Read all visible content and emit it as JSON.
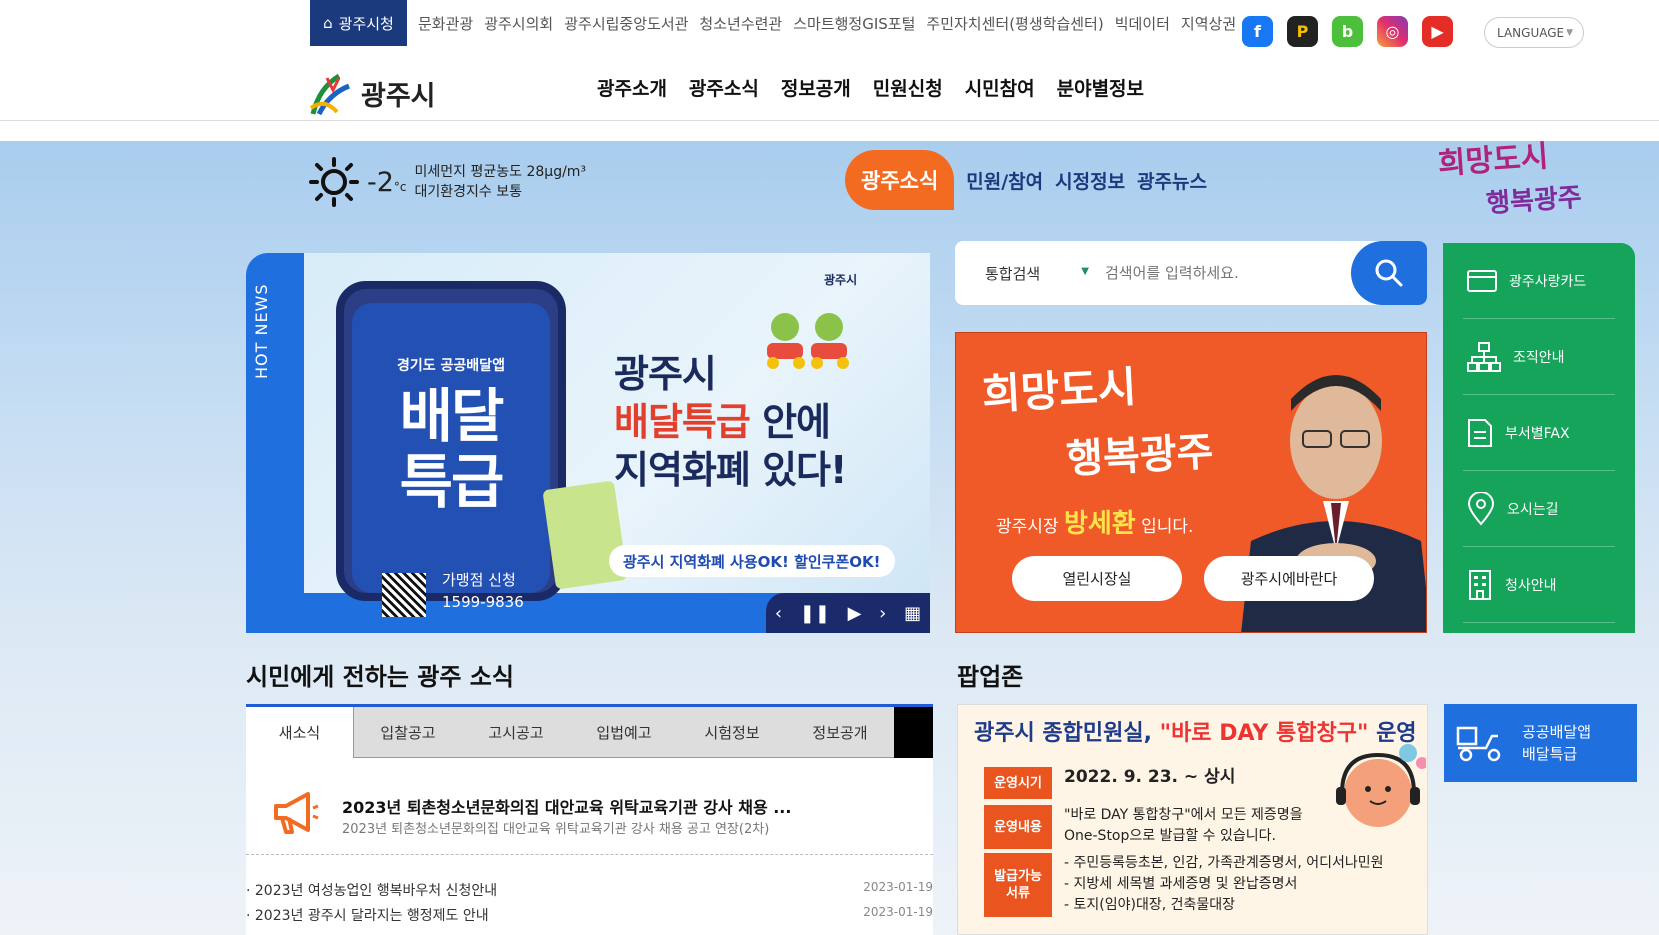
{
  "topbar": {
    "home_label": "광주시청",
    "links": [
      "문화관광",
      "광주시의회",
      "광주시립중앙도서관",
      "청소년수련관",
      "스마트행정GIS포털",
      "주민자치센터(평생학습센터)",
      "빅데이터",
      "지역상권"
    ],
    "language": "LANGUAGE"
  },
  "logo": {
    "name": "광주시"
  },
  "gnb": [
    "광주소개",
    "광주소식",
    "정보공개",
    "민원신청",
    "시민참여",
    "분야별정보"
  ],
  "weather": {
    "temp": "-2",
    "unit": "°c",
    "dust": "미세먼지 평균농도 28μg/m³",
    "air": "대기환경지수 보통"
  },
  "news_tabs": {
    "active": "광주소식",
    "others": [
      "민원/참여",
      "시정정보",
      "광주뉴스"
    ]
  },
  "slogan": {
    "line1": "희망도시",
    "line2": "행복광주"
  },
  "hot_news": {
    "label": "HOT NEWS",
    "phone_title": "경기도 공공배달앱",
    "phone_big1": "배달",
    "phone_big2": "특급",
    "shop_label": "가맹점 신청",
    "shop_phone": "1599-9836",
    "line1": "광주시",
    "line2a": "배달특급",
    "line2b": " 안에",
    "line3": "지역화폐 있다!",
    "sub": "광주시 지역화폐 사용OK! 할인쿠폰OK!",
    "brand": "광주시"
  },
  "search": {
    "category": "통합검색",
    "placeholder": "검색어를 입력하세요."
  },
  "mayor": {
    "cal1": "희망도시",
    "cal2": "행복광주",
    "prefix": "광주시장 ",
    "name": "방세환",
    "suffix": " 입니다.",
    "btn1": "열린시장실",
    "btn2": "광주시에바란다"
  },
  "quick_menu": [
    {
      "label": "광주사랑카드",
      "icon": "card-icon"
    },
    {
      "label": "조직안내",
      "icon": "org-chart-icon"
    },
    {
      "label": "부서별FAX",
      "icon": "fax-icon"
    },
    {
      "label": "오시는길",
      "icon": "location-pin-icon"
    },
    {
      "label": "청사안내",
      "icon": "building-icon"
    }
  ],
  "section_news": {
    "title": "시민에게 전하는 광주 소식"
  },
  "section_popup": {
    "title": "팝업존"
  },
  "board_tabs": [
    "새소식",
    "입찰공고",
    "고시공고",
    "입법예고",
    "시험정보",
    "정보공개"
  ],
  "featured": {
    "title": "2023년 퇴촌청소년문화의집 대안교육 위탁교육기관 강사 채용 ...",
    "summary": "2023년 퇴촌청소년문화의집 대안교육 위탁교육기관 강사 채용 공고 연장(2차)"
  },
  "news_list": [
    {
      "title": "· 2023년 여성농업인 행복바우처 신청안내",
      "date": "2023-01-19"
    },
    {
      "title": "· 2023년 광주시 달라지는 행정제도 안내",
      "date": "2023-01-19"
    }
  ],
  "popup": {
    "title_a": "광주시 종합민원실, ",
    "title_b": "\"바로 DAY 통합창구\"",
    "title_c": " 운영",
    "r1_tag": "운영시기",
    "r1_text": "2022. 9. 23. ~ 상시",
    "r2_tag": "운영내용",
    "r2_text1": "\"바로 DAY 통합창구\"에서 모든 제증명을",
    "r2_text2": "One-Stop으로 발급할 수 있습니다.",
    "r3_tag": "발급가능 서류",
    "r3_text1": "- 주민등록등초본, 인감, 가족관계증명서, 어디서나민원",
    "r3_text2": "- 지방세 세목별 과세증명 및 완납증명서",
    "r3_text3": "- 토지(임야)대장, 건축물대장"
  },
  "delivery": {
    "line1": "공공배달앱",
    "line2": "배달특급"
  },
  "colors": {
    "navy": "#1b3a7d",
    "orange": "#f36a21",
    "green": "#16a35a",
    "blue": "#1f6fde"
  }
}
